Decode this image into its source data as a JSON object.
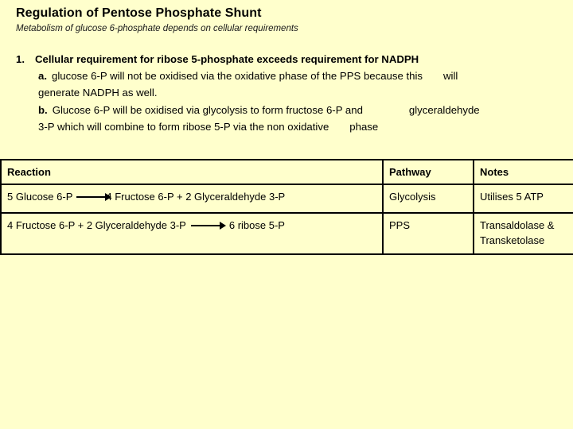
{
  "slide": {
    "background_color": "#ffffcc",
    "text_color": "#000000",
    "title": "Regulation of Pentose Phosphate Shunt",
    "subtitle": "Metabolism of glucose 6-phosphate depends on cellular  requirements"
  },
  "body": {
    "item1_number": "1.",
    "item1_text": "Cellular requirement for ribose 5-phosphate exceeds requirement for NADPH",
    "item_a_label": "a.",
    "item_a_text": "glucose 6-P will not be oxidised via the oxidative phase of the PPS because this",
    "item_a_text_tail": "will",
    "item_a_line2": "generate NADPH as well.",
    "item_b_label": "b.",
    "item_b_text": "Glucose 6-P will be oxidised via glycolysis to form fructose 6-P and",
    "item_b_text_tail": "glyceraldehyde",
    "item_b_line2": "3-P which will combine to form ribose 5-P via the non oxidative",
    "item_b_line2_tail": "phase"
  },
  "table": {
    "headers": [
      "Reaction",
      "Pathway",
      "Notes"
    ],
    "rows": [
      {
        "reaction_left": "5 Glucose 6-P",
        "reaction_arrow": "right-arrow-icon",
        "reaction_right": "4 Fructose 6-P  + 2 Glyceraldehyde 3-P",
        "pathway": "Glycolysis",
        "notes": "Utilises 5 ATP"
      },
      {
        "reaction_left": "4 Fructose 6-P + 2 Glyceraldehyde 3-P",
        "reaction_arrow": "right-arrow-icon",
        "reaction_right": "6 ribose 5-P",
        "pathway": "PPS",
        "notes_line1": "Transaldolase &",
        "notes_line2": "Transketolase"
      }
    ]
  }
}
